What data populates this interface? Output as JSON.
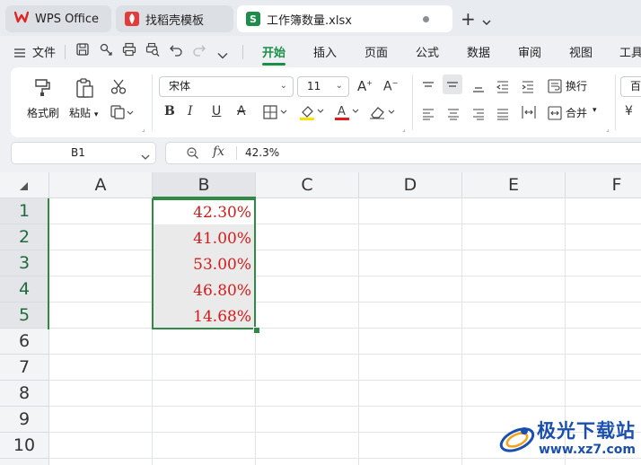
{
  "tabs": [
    {
      "label": "WPS Office"
    },
    {
      "label": "找稻壳模板"
    },
    {
      "label": "工作簿数量.xlsx"
    }
  ],
  "menu": {
    "file_label": "文件",
    "items": [
      "开始",
      "插入",
      "页面",
      "公式",
      "数据",
      "审阅",
      "视图",
      "工具"
    ]
  },
  "ribbon": {
    "format_painter": "格式刷",
    "paste": "粘贴",
    "font_name": "宋体",
    "font_size": "11",
    "wrap_text": "换行",
    "merge": "合并",
    "percent_partial": "百"
  },
  "formula_bar": {
    "cell_ref": "B1",
    "formula": "42.3%"
  },
  "sheet": {
    "columns": [
      "A",
      "B",
      "C",
      "D",
      "E",
      "F"
    ],
    "rows": [
      "1",
      "2",
      "3",
      "4",
      "5",
      "6",
      "7",
      "8",
      "9",
      "10"
    ],
    "cells_B": [
      "42.30%",
      "41.00%",
      "53.00%",
      "46.80%",
      "14.68%"
    ]
  },
  "colors": {
    "accent": "#1a8f47",
    "selection": "#2f8a43",
    "value_text": "#d61a1a"
  },
  "watermark": {
    "title": "极光下载站",
    "url": "www.xz7.com"
  }
}
